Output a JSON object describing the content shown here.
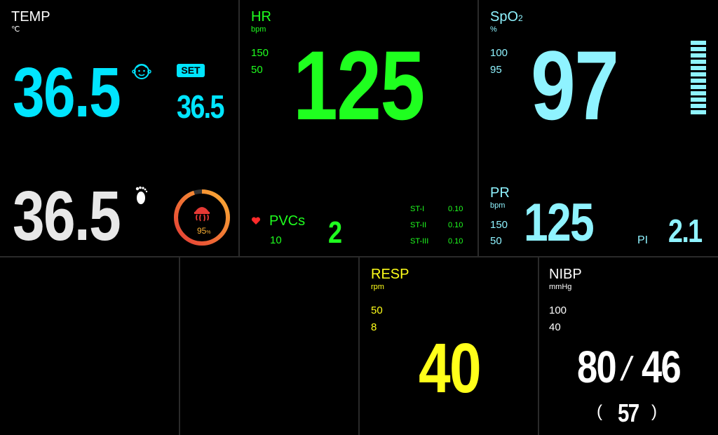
{
  "temp": {
    "title": "TEMP",
    "unit": "℃",
    "value_baby": "36.5",
    "set_badge": "SET",
    "set_value": "36.5",
    "value_foot": "36.5",
    "ring_percent_label": "95",
    "ring_percent_unit": "%",
    "ring_fraction": 0.95,
    "icons": [
      "baby-face-icon",
      "footprint-icon",
      "heater-icon"
    ]
  },
  "hr": {
    "title": "HR",
    "unit": "bpm",
    "limit_high": "150",
    "limit_low": "50",
    "value": "125",
    "pvcs_label": "PVCs",
    "pvcs_limit": "10",
    "pvcs_value": "2",
    "st": [
      {
        "label": "ST-I",
        "value": "0.10"
      },
      {
        "label": "ST-II",
        "value": "0.10"
      },
      {
        "label": "ST-III",
        "value": "0.10"
      }
    ]
  },
  "spo2": {
    "title": "SpO",
    "title_sub": "2",
    "unit": "%",
    "limit_high": "100",
    "limit_low": "95",
    "value": "97",
    "pr_title": "PR",
    "pr_unit": "bpm",
    "pr_limit_high": "150",
    "pr_limit_low": "50",
    "pr_value": "125",
    "pi_label": "PI",
    "pi_value": "2.1",
    "signal_bars_total": 12,
    "signal_bars_lit": 12
  },
  "resp": {
    "title": "RESP",
    "unit": "rpm",
    "limit_high": "50",
    "limit_low": "8",
    "value": "40"
  },
  "nibp": {
    "title": "NIBP",
    "unit": "mmHg",
    "limit_high": "100",
    "limit_low": "40",
    "systolic": "80",
    "separator": "/",
    "diastolic": "46",
    "paren_open": "(",
    "mean": "57",
    "paren_close": ")"
  },
  "colors": {
    "temp": "#00e5ff",
    "hr": "#1fff1f",
    "spo2": "#8ff3ff",
    "resp": "#ffff1a",
    "nibp": "#ffffff",
    "heart": "#ff2a2a",
    "ring_start": "#e53935",
    "ring_end": "#fbb034"
  }
}
